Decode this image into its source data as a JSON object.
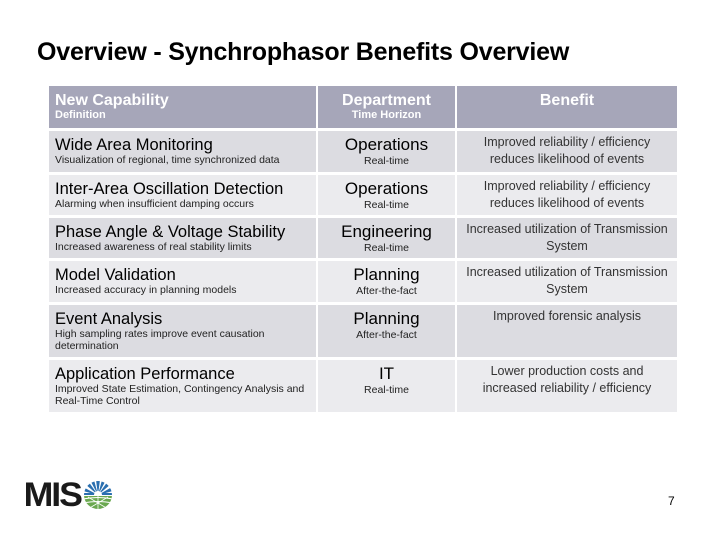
{
  "slide": {
    "title": "Overview - Synchrophasor Benefits Overview",
    "page_number": "7"
  },
  "table": {
    "headers": {
      "capability": "New Capability",
      "capability_sub": "Definition",
      "department": "Department",
      "department_sub": "Time Horizon",
      "benefit": "Benefit"
    },
    "rows": [
      {
        "capability": "Wide Area Monitoring",
        "definition": "Visualization of regional, time synchronized data",
        "department": "Operations",
        "horizon": "Real-time",
        "benefit": "Improved reliability / efficiency reduces likelihood of events"
      },
      {
        "capability": "Inter-Area Oscillation Detection",
        "definition": "Alarming when insufficient damping occurs",
        "department": "Operations",
        "horizon": "Real-time",
        "benefit": "Improved reliability / efficiency reduces likelihood of events"
      },
      {
        "capability": "Phase Angle & Voltage Stability",
        "definition": "Increased awareness of real stability limits",
        "department": "Engineering",
        "horizon": "Real-time",
        "benefit": "Increased utilization of Transmission System"
      },
      {
        "capability": "Model Validation",
        "definition": "Increased accuracy in planning models",
        "department": "Planning",
        "horizon": "After-the-fact",
        "benefit": "Increased utilization of Transmission System"
      },
      {
        "capability": "Event  Analysis",
        "definition": "High sampling rates improve event causation determination",
        "department": "Planning",
        "horizon": "After-the-fact",
        "benefit": "Improved forensic analysis"
      },
      {
        "capability": "Application Performance",
        "definition": "Improved State Estimation, Contingency Analysis and Real-Time Control",
        "department": "IT",
        "horizon": "Real-time",
        "benefit": "Lower production costs and increased reliability / efficiency"
      }
    ]
  },
  "logo": {
    "text": "MIS",
    "icon": "miso-sun-globe-icon"
  },
  "colors": {
    "header_bg": "#a6a6b9",
    "row_dark": "#dcdce1",
    "row_light": "#ebebee",
    "logo_blue": "#2a6fb0",
    "logo_green": "#6aa84f"
  }
}
